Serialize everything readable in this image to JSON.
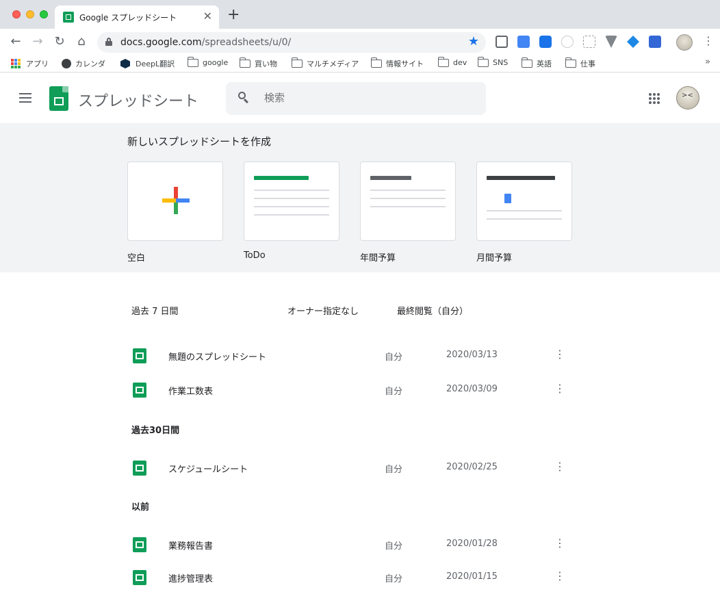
{
  "browser": {
    "tab_title": "Google スプレッドシート",
    "tab_close": "✕",
    "new_tab": "+",
    "url_host": "docs.google.com",
    "url_path": "/spreadsheets/u/0/",
    "nav": {
      "back": "←",
      "forward": "→",
      "reload": "↻",
      "home": "⌂"
    },
    "star": "★",
    "menu": "⋮",
    "more_bookmarks": "»"
  },
  "bookmarks": [
    {
      "label": "アプリ",
      "icon": "apps-grid-icon"
    },
    {
      "label": "カレンダ",
      "icon": "globe-icon"
    },
    {
      "label": "DeepL翻訳",
      "icon": "deepl-icon"
    },
    {
      "label": "google",
      "icon": "folder-icon"
    },
    {
      "label": "買い物",
      "icon": "folder-icon"
    },
    {
      "label": "マルチメディア",
      "icon": "folder-icon"
    },
    {
      "label": "情報サイト",
      "icon": "folder-icon"
    },
    {
      "label": "dev",
      "icon": "folder-icon"
    },
    {
      "label": "SNS",
      "icon": "folder-icon"
    },
    {
      "label": "英語",
      "icon": "folder-icon"
    },
    {
      "label": "仕事",
      "icon": "folder-icon"
    }
  ],
  "app": {
    "name": "スプレッドシート",
    "search_placeholder": "検索"
  },
  "gallery": {
    "heading": "新しいスプレッドシートを作成",
    "templates": [
      {
        "label": "空白"
      },
      {
        "label": "ToDo"
      },
      {
        "label": "年間予算"
      },
      {
        "label": "月間予算"
      }
    ]
  },
  "list": {
    "columns": {
      "filter": "過去 7 日間",
      "owner": "オーナー指定なし",
      "sort": "最終閲覧（自分）"
    },
    "groups": [
      {
        "title": "",
        "rows": [
          {
            "name": "無題のスプレッドシート",
            "owner": "自分",
            "date": "2020/03/13"
          },
          {
            "name": "作業工数表",
            "owner": "自分",
            "date": "2020/03/09"
          }
        ]
      },
      {
        "title": "過去30日間",
        "rows": [
          {
            "name": "スケジュールシート",
            "owner": "自分",
            "date": "2020/02/25"
          }
        ]
      },
      {
        "title": "以前",
        "rows": [
          {
            "name": "業務報告書",
            "owner": "自分",
            "date": "2020/01/28"
          },
          {
            "name": "進捗管理表",
            "owner": "自分",
            "date": "2020/01/15"
          }
        ]
      }
    ],
    "more": "⋮"
  }
}
